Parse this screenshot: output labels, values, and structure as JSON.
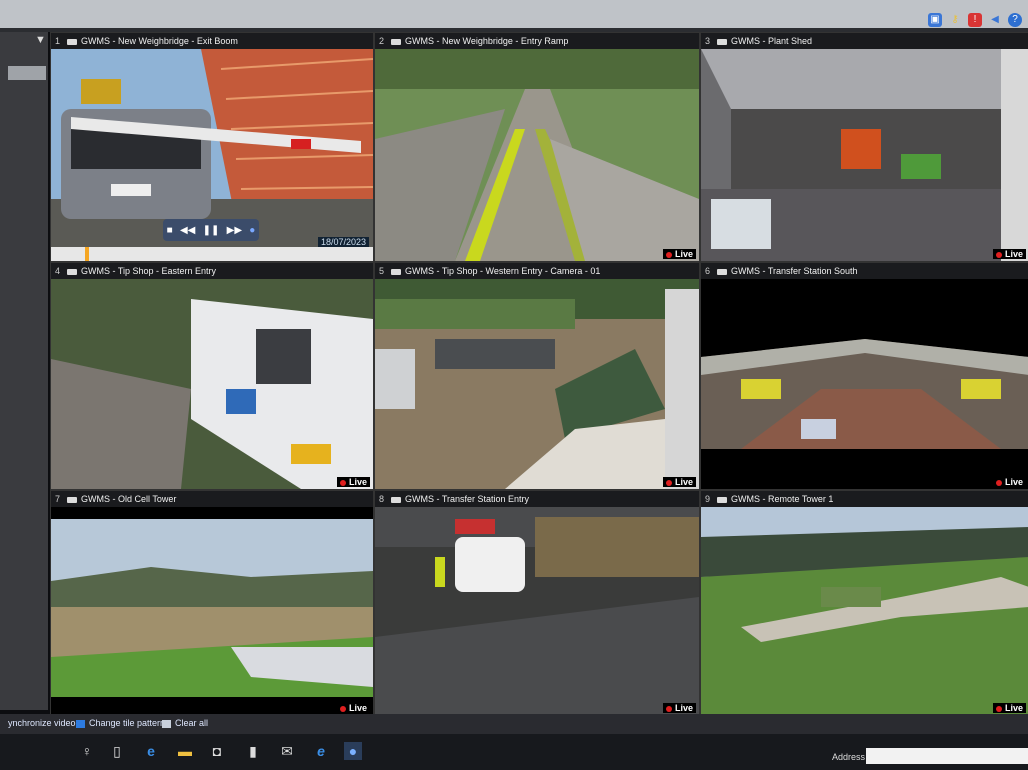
{
  "tiles": [
    {
      "num": "1",
      "title": "GWMS - New Weighbridge - Exit Boom",
      "date": "18/07/2023",
      "status": ""
    },
    {
      "num": "2",
      "title": "GWMS - New Weighbridge - Entry Ramp",
      "status": "Live"
    },
    {
      "num": "3",
      "title": "GWMS - Plant Shed",
      "status": "Live"
    },
    {
      "num": "4",
      "title": "GWMS - Tip Shop - Eastern Entry",
      "status": "Live"
    },
    {
      "num": "5",
      "title": "GWMS - Tip Shop - Western Entry - Camera - 01",
      "status": "Live"
    },
    {
      "num": "6",
      "title": "GWMS - Transfer Station South",
      "status": "Live"
    },
    {
      "num": "7",
      "title": "GWMS - Old Cell Tower",
      "status": "Live"
    },
    {
      "num": "8",
      "title": "GWMS - Transfer Station Entry",
      "status": "Live"
    },
    {
      "num": "9",
      "title": "GWMS - Remote Tower 1",
      "status": "Live"
    }
  ],
  "toolbar": {
    "sync_label": "ynchronize video",
    "pattern_label": "Change tile pattern",
    "clear_label": "Clear all"
  },
  "taskbar": {
    "address_label": "Address"
  },
  "colors": {
    "live_dot": "#e01f1f",
    "accent": "#1e78d8"
  }
}
